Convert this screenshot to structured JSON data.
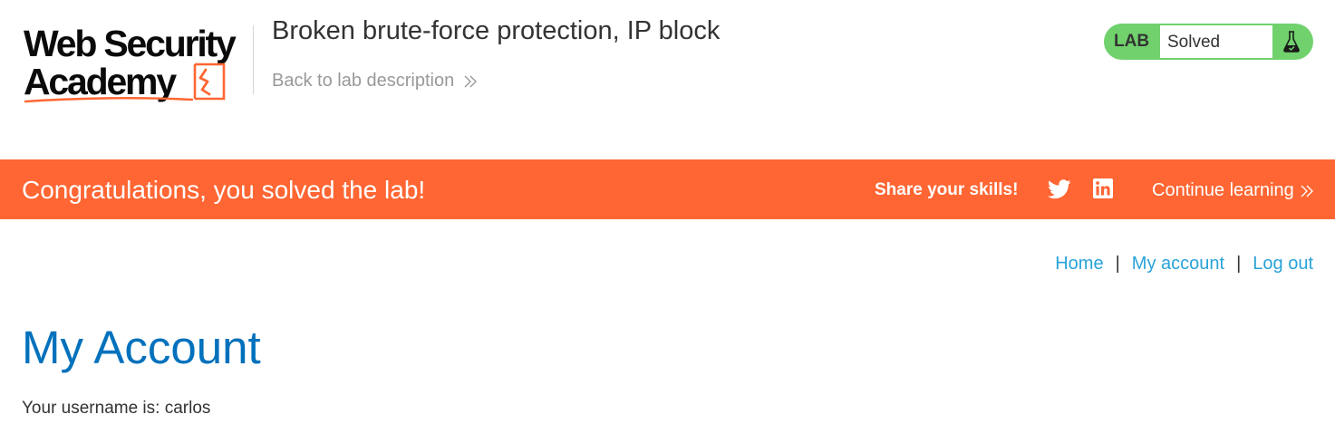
{
  "header": {
    "logo": {
      "line1": "Web Security",
      "line2": "Academy",
      "icon": "academy-logo-icon"
    },
    "lab_title": "Broken brute-force protection, IP block",
    "back_link": "Back to lab description",
    "lab_status": {
      "tag": "LAB",
      "state": "Solved",
      "icon": "flask-icon"
    }
  },
  "banner": {
    "message": "Congratulations, you solved the lab!",
    "share_label": "Share your skills!",
    "share_icons": [
      "twitter-icon",
      "linkedin-icon"
    ],
    "continue_label": "Continue learning"
  },
  "nav": {
    "home": "Home",
    "my_account": "My account",
    "log_out": "Log out",
    "separator": "|"
  },
  "main": {
    "title": "My Account",
    "username_line": "Your username is: carlos"
  },
  "colors": {
    "banner": "#ff6633",
    "status_green": "#70d16d",
    "link": "#29a3d8",
    "title": "#0071bc",
    "logo_accent": "#ff6633"
  }
}
